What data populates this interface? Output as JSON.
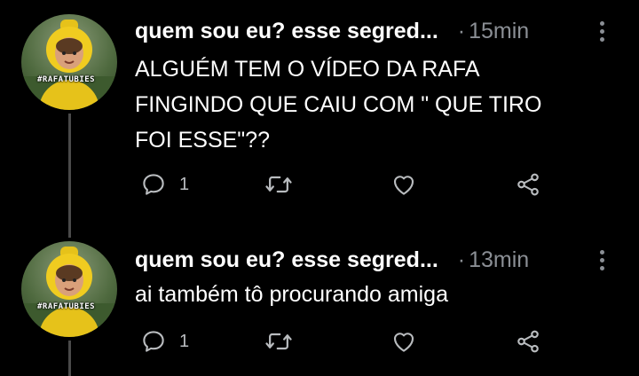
{
  "tweets": [
    {
      "author": "quem sou eu? esse segred...",
      "separator": "·",
      "time": "15min",
      "text_lines": [
        "ALGUÉM TEM O VÍDEO DA RAFA",
        "FINGINDO QUE CAIU COM \" QUE TIRO",
        "FOI ESSE\"??"
      ],
      "replies": "1",
      "avatar_text": "#RAFATUBIES",
      "icons": [
        "reply-icon",
        "retweet-icon",
        "like-icon",
        "share-icon",
        "more-icon"
      ]
    },
    {
      "author": "quem sou eu? esse segred...",
      "separator": "·",
      "time": "13min",
      "text_lines": [
        "ai também tô procurando amiga"
      ],
      "replies": "1",
      "avatar_text": "#RAFATUBIES",
      "icons": [
        "reply-icon",
        "retweet-icon",
        "like-icon",
        "share-icon",
        "more-icon"
      ]
    }
  ],
  "colors": {
    "background": "#000000",
    "text": "#ffffff",
    "muted": "#8b8f95",
    "thread_line": "#4a4a4a"
  }
}
